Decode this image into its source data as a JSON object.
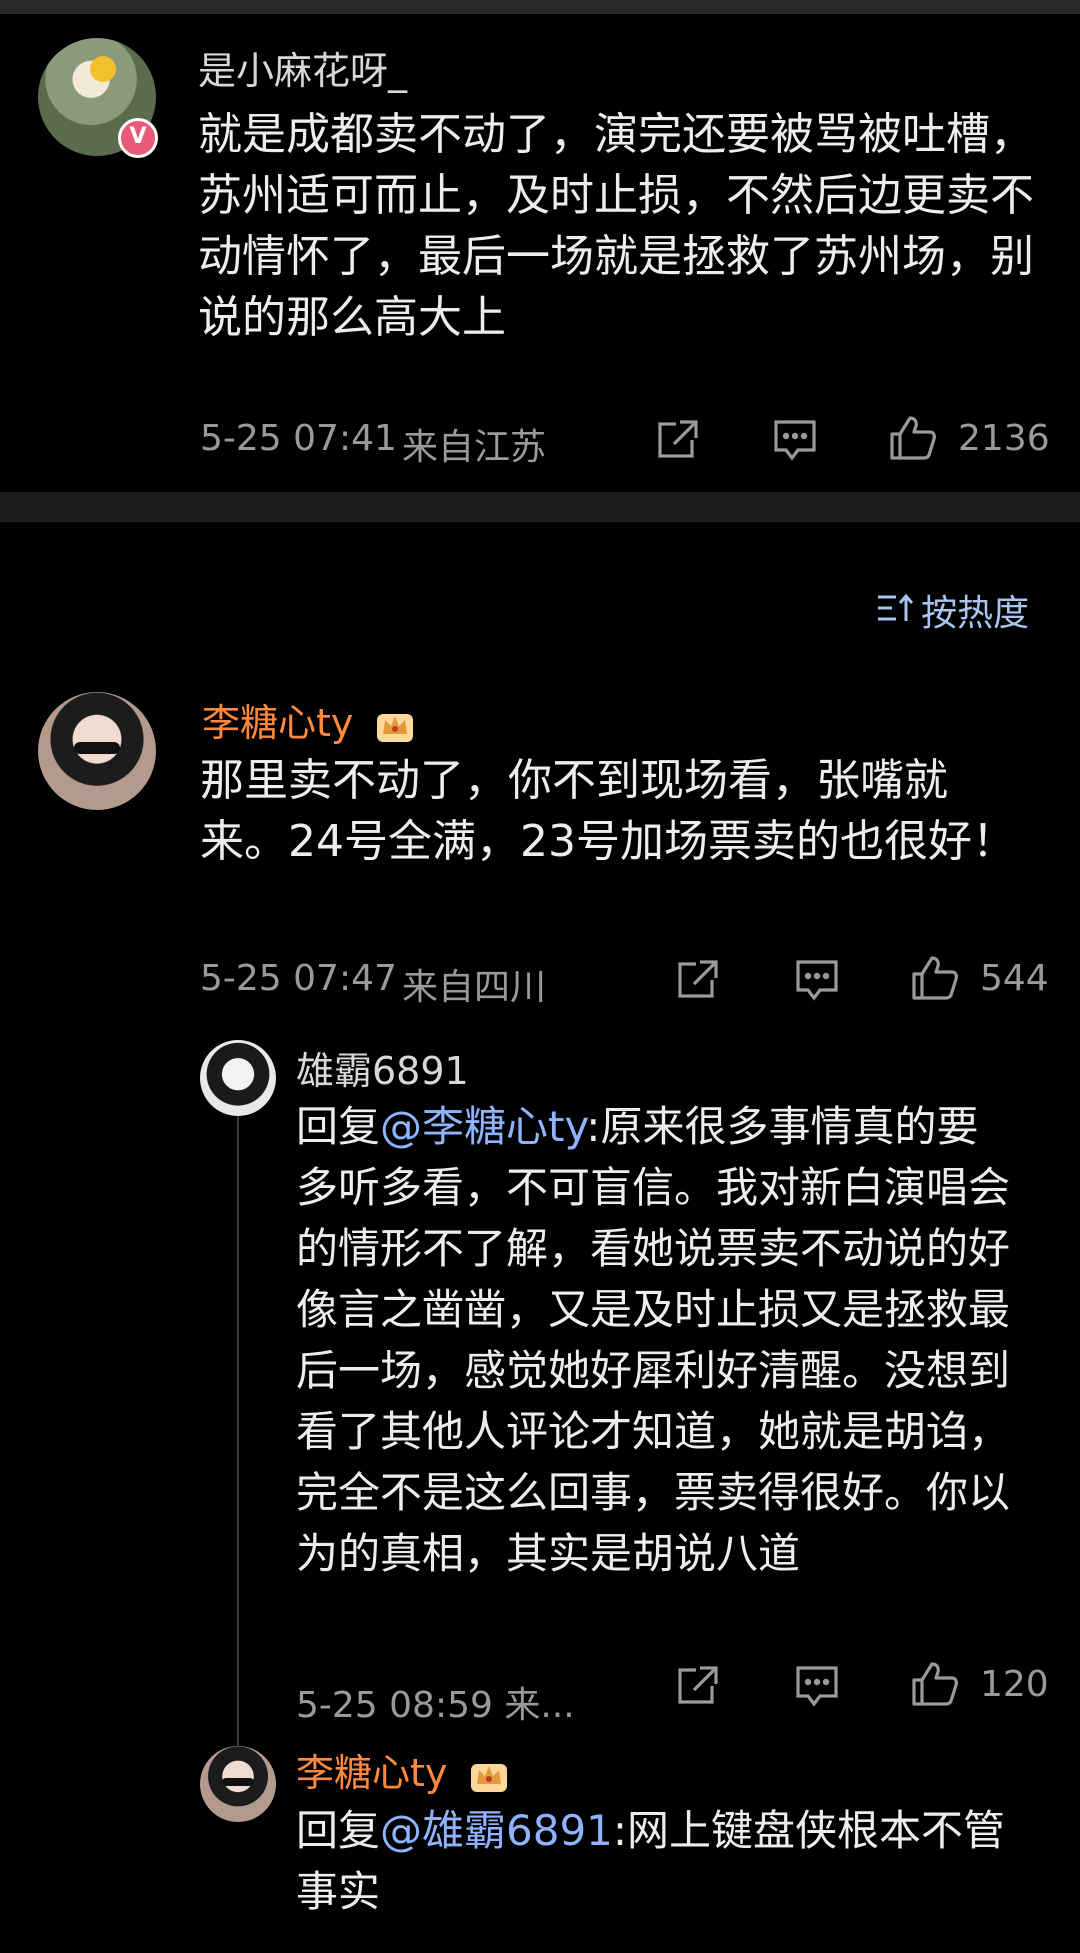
{
  "comments": [
    {
      "author": "是小麻花呀_",
      "text": "就是成都卖不动了，演完还要被骂被吐槽，苏州适可而止，及时止损，不然后边更卖不动情怀了，最后一场就是拯救了苏州场，别说的那么高大上",
      "time": "5-25 07:41",
      "location": "来自江苏",
      "likes": "2136",
      "badge": "V"
    },
    {
      "author": "李糖心ty",
      "text": "那里卖不动了，你不到现场看，张嘴就来。24号全满，23号加场票卖的也很好！",
      "time": "5-25 07:47",
      "location": "来自四川",
      "likes": "544"
    }
  ],
  "sort_label": "按热度",
  "replies": [
    {
      "author": "雄霸6891",
      "prefix": "回复",
      "mention": "@李糖心ty",
      "text": ":原来很多事情真的要多听多看，不可盲信。我对新白演唱会的情形不了解，看她说票卖不动说的好像言之凿凿，又是及时止损又是拯救最后一场，感觉她好犀利好清醒。没想到看了其他人评论才知道，她就是胡诌，完全不是这么回事，票卖得很好。你以为的真相，其实是胡说八道",
      "meta": "5-25 08:59  来...",
      "likes": "120"
    },
    {
      "author": "李糖心ty",
      "prefix": "回复",
      "mention": "@雄霸6891",
      "text": ":网上键盘侠根本不管事实"
    }
  ],
  "colors": {
    "background": "#000000",
    "vip_name": "#ff8a3d",
    "mention": "#8fb3ff",
    "meta": "#9a9a9a",
    "sort": "#a9c4ef"
  },
  "icons": [
    "share-icon",
    "comment-icon",
    "like-icon",
    "sort-icon",
    "crown-icon",
    "verified-badge-icon"
  ]
}
